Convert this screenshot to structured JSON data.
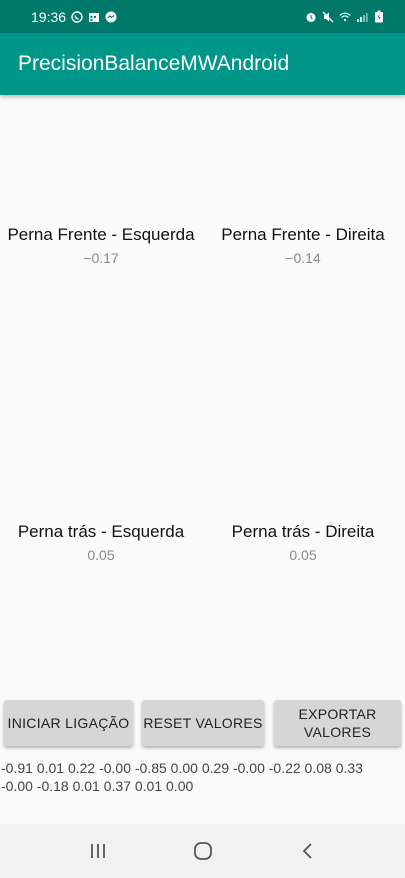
{
  "status_bar": {
    "time": "19:36",
    "left_icons": [
      "whatsapp-icon",
      "calendar-icon",
      "messenger-icon"
    ],
    "right_icons": [
      "alarm-icon",
      "mute-icon",
      "wifi-icon",
      "signal-icon",
      "battery-icon"
    ]
  },
  "app_bar": {
    "title": "PrecisionBalanceMWAndroid"
  },
  "sensors": {
    "front_left": {
      "label": "Perna Frente - Esquerda",
      "value": "−0.17"
    },
    "front_right": {
      "label": "Perna Frente - Direita",
      "value": "−0.14"
    },
    "rear_left": {
      "label": "Perna trás - Esquerda",
      "value": "0.05"
    },
    "rear_right": {
      "label": "Perna trás - Direita",
      "value": "0.05"
    }
  },
  "buttons": {
    "connect": "INICIAR LIGAÇÃO",
    "reset": "RESET VALORES",
    "export_line1": "EXPORTAR",
    "export_line2": "VALORES"
  },
  "log": {
    "line1": "-0.91 0.01 0.22 -0.00 -0.85 0.00 0.29 -0.00 -0.22 0.08 0.33",
    "line2": "-0.00 -0.18 0.01 0.37 0.01 0.00"
  },
  "colors": {
    "status_bar": "#00796b",
    "app_bar": "#009688",
    "button": "#d6d6d6"
  }
}
